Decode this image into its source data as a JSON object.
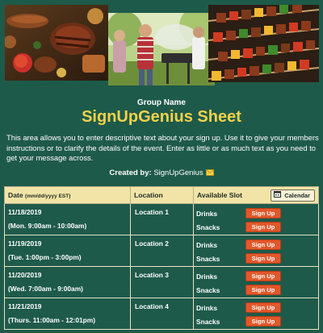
{
  "header": {
    "group_name": "Group Name",
    "title": "SignUpGenius Sheet",
    "description": "This area allows you to enter descriptive text about your sign up. Use it to give your members instructions or to clarify the details of the event. Enter as little or as much text as you need to get your message across.",
    "created_by_label": "Created by:",
    "created_by_name": "SignUpGenius"
  },
  "banner": {
    "photos": [
      "grilled-meats-photo",
      "backyard-barbecue-photo",
      "kebab-skewers-photo"
    ]
  },
  "table": {
    "col_date": "Date",
    "col_date_format": "(mm/dd/yyyy EST)",
    "col_location": "Location",
    "col_slot": "Available Slot",
    "calendar_label": "Calendar",
    "rows": [
      {
        "date": "11/18/2019",
        "time": "(Mon. 9:00am - 10:00am)",
        "location": "Location 1",
        "slots": [
          {
            "name": "Drinks",
            "button": "Sign Up"
          },
          {
            "name": "Snacks",
            "button": "Sign Up"
          }
        ]
      },
      {
        "date": "11/19/2019",
        "time": "(Tue. 1:00pm - 3:00pm)",
        "location": "Location 2",
        "slots": [
          {
            "name": "Drinks",
            "button": "Sign Up"
          },
          {
            "name": "Snacks",
            "button": "Sign Up"
          }
        ]
      },
      {
        "date": "11/20/2019",
        "time": "(Wed. 7:00am - 9:00am)",
        "location": "Location 3",
        "slots": [
          {
            "name": "Drinks",
            "button": "Sign Up"
          },
          {
            "name": "Snacks",
            "button": "Sign Up"
          }
        ]
      },
      {
        "date": "11/21/2019",
        "time": "(Thurs. 11:00am - 12:01pm)",
        "location": "Location 4",
        "slots": [
          {
            "name": "Drinks",
            "button": "Sign Up"
          },
          {
            "name": "Snacks",
            "button": "Sign Up"
          }
        ]
      }
    ]
  },
  "colors": {
    "background": "#1e5a4a",
    "title": "#f2d24a",
    "header_row": "#f1e4a6",
    "button": "#e2582b"
  }
}
